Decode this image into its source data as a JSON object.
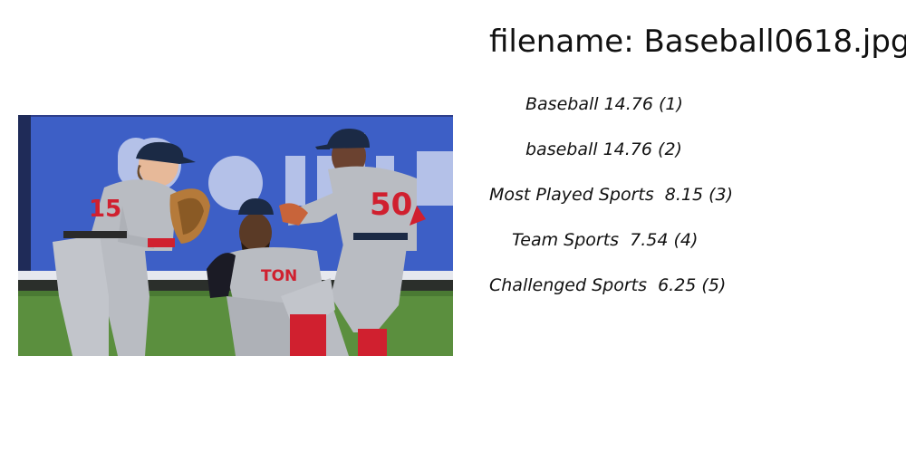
{
  "filename_line": "filename: Baseball0618.jpg",
  "tags": [
    "Baseball 14.76 (1)",
    "baseball 14.76 (2)",
    "Most Played Sports  8.15 (3)",
    "Team Sports  7.54 (4)",
    "Challenged Sports  6.25 (5)"
  ],
  "colors": {
    "wall_blue": "#3d5fc6",
    "grass": "#5b8f3e",
    "uniform_gray": "#b9bcc2",
    "sock_red": "#d0202f",
    "cap_navy": "#1b2a45"
  }
}
